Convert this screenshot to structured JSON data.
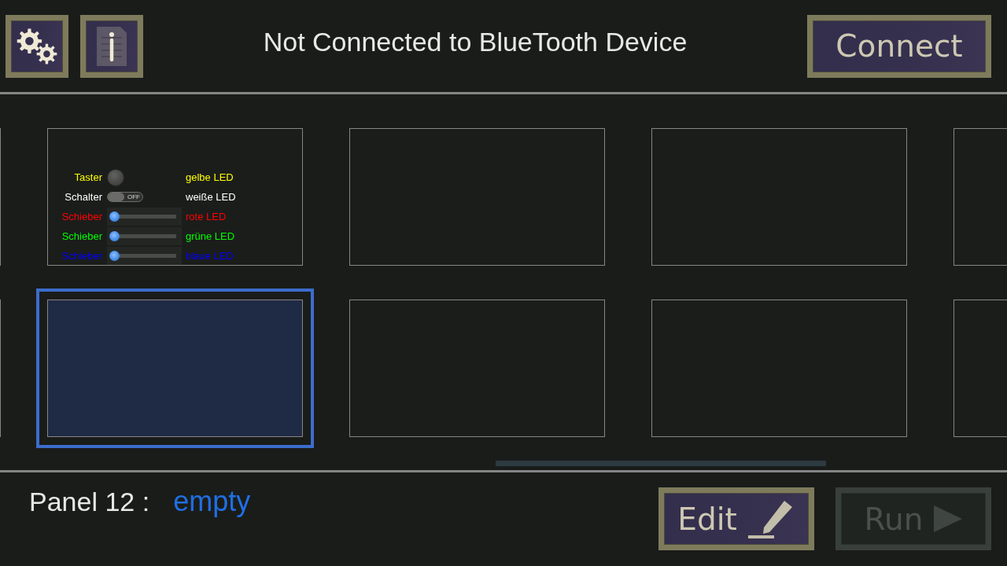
{
  "header": {
    "title": "Not Connected to BlueTooth Device",
    "connect_button": "Connect"
  },
  "panel_rows": [
    {
      "panels": [
        {
          "selected": false,
          "widgets": [
            {
              "kind": "button",
              "label": "Taster",
              "output": "gelbe LED",
              "color": "#ffff00"
            },
            {
              "kind": "switch",
              "label": "Schalter",
              "switch_text": "OFF",
              "on": false,
              "output": "weiße LED",
              "color": "#ffffff"
            },
            {
              "kind": "slider",
              "label": "Schieber",
              "level": 0,
              "output": "rote LED",
              "color": "#ff0000"
            },
            {
              "kind": "slider",
              "label": "Schieber",
              "level": 0,
              "output": "grüne LED",
              "color": "#00ff00"
            },
            {
              "kind": "slider",
              "label": "Schieber",
              "level": 0,
              "output": "blaue LED",
              "color": "#0000ff"
            }
          ]
        },
        {
          "selected": false
        },
        {
          "selected": false
        },
        {
          "selected": false
        }
      ]
    },
    {
      "panels": [
        {
          "selected": true
        },
        {
          "selected": false
        },
        {
          "selected": false
        },
        {
          "selected": false
        }
      ]
    }
  ],
  "footer": {
    "panel_label": "Panel 12 :",
    "panel_status": "empty",
    "buttons": [
      {
        "kind": "edit",
        "label": "Edit",
        "disabled": false
      },
      {
        "kind": "run",
        "label": "Run",
        "disabled": true
      }
    ]
  }
}
